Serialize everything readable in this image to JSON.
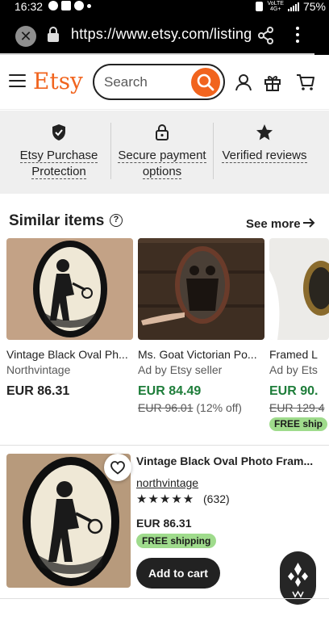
{
  "status_bar": {
    "time": "16:32",
    "network_line1": "VoLTE",
    "network_line2": "4G+",
    "battery": "75%"
  },
  "browser": {
    "url": "https://www.etsy.com/listing",
    "close_icon": "close-icon",
    "lock_icon": "lock-icon",
    "share_icon": "share-icon",
    "menu_icon": "more-vertical-icon"
  },
  "header": {
    "logo": "Etsy",
    "search_placeholder": "Search",
    "brand_color": "#f1641e"
  },
  "trust_banner": [
    {
      "icon": "shield-check-icon",
      "line1": "Etsy Purchase",
      "line2": "Protection"
    },
    {
      "icon": "lock-icon",
      "line1": "Secure payment",
      "line2": "options"
    },
    {
      "icon": "star-icon",
      "line1": "Verified reviews",
      "line2": ""
    }
  ],
  "similar": {
    "title": "Similar items",
    "info_glyph": "?",
    "see_more": "See more",
    "items": [
      {
        "title": "Vintage Black Oval Ph...",
        "shop": "Northvintage",
        "price": "EUR 86.31",
        "original": "",
        "discount": "",
        "badge": ""
      },
      {
        "title": "Ms. Goat Victorian Po...",
        "shop": "Ad by Etsy seller",
        "price": "EUR 84.49",
        "original": "EUR 96.01",
        "discount": " (12% off)",
        "badge": ""
      },
      {
        "title": "Framed L",
        "shop": "Ad by Ets",
        "price": "EUR 90.",
        "original": "EUR 129.4",
        "discount": "",
        "badge": "FREE ship"
      }
    ]
  },
  "listing": {
    "title": "Vintage Black Oval Photo Fram...",
    "shop": "northvintage",
    "stars": "★★★★★",
    "rating_value": 5,
    "review_count": "(632)",
    "price": "EUR 86.31",
    "shipping_badge": "FREE shipping",
    "add_to_cart": "Add to cart"
  },
  "colors": {
    "accent": "#f1641e",
    "sale_green": "#1e7d3a",
    "free_shipping_bg": "#9fdb8c",
    "banner_bg": "#efefef"
  }
}
